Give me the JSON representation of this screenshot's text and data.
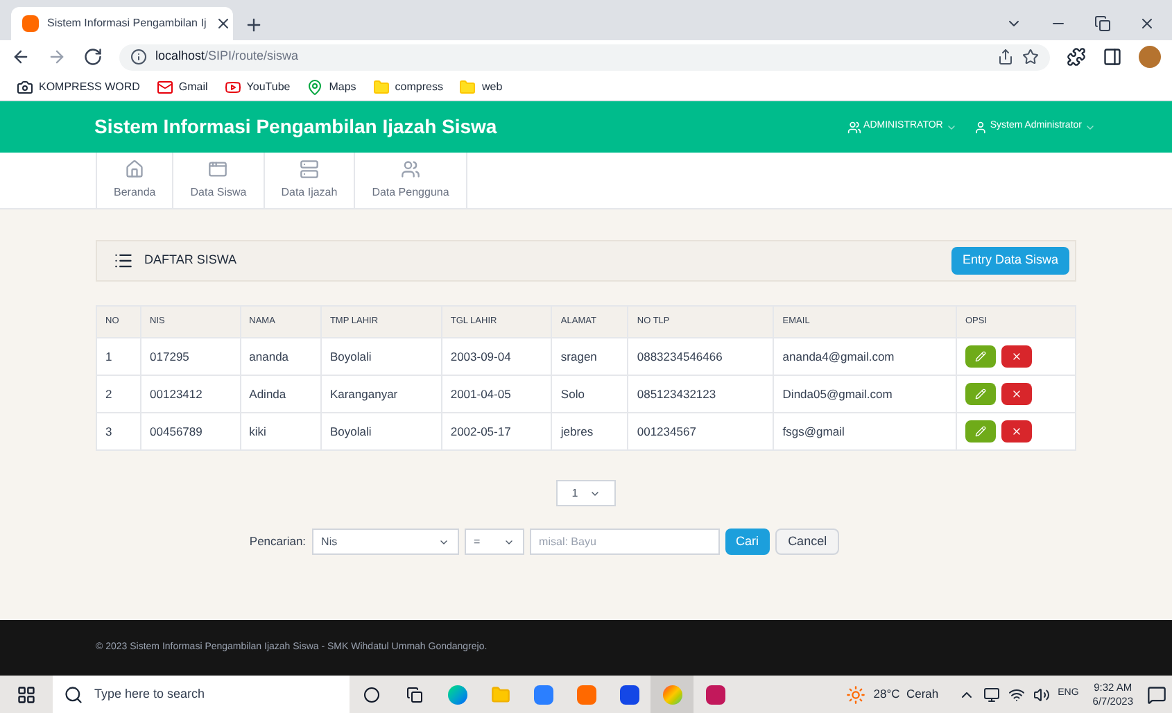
{
  "browser": {
    "tab_title": "Sistem Informasi Pengambilan Ij",
    "url_host": "localhost",
    "url_path": "/SIPI/route/siswa",
    "bookmarks": [
      {
        "label": "KOMPRESS WORD",
        "kind": "camera"
      },
      {
        "label": "Gmail",
        "kind": "gmail"
      },
      {
        "label": "YouTube",
        "kind": "youtube"
      },
      {
        "label": "Maps",
        "kind": "maps"
      },
      {
        "label": "compress",
        "kind": "folder"
      },
      {
        "label": "web",
        "kind": "folder"
      }
    ]
  },
  "header": {
    "title": "Sistem Informasi Pengambilan Ijazah Siswa",
    "role_menu": "ADMINISTRATOR",
    "user_menu": "System Administrator"
  },
  "nav": [
    {
      "label": "Beranda",
      "kind": "home",
      "selected": false
    },
    {
      "label": "Data Siswa",
      "kind": "window",
      "selected": false
    },
    {
      "label": "Data Ijazah",
      "kind": "server",
      "selected": false
    },
    {
      "label": "Data Pengguna",
      "kind": "users",
      "selected": false
    }
  ],
  "panel": {
    "title": "DAFTAR SISWA",
    "entry_button": "Entry Data Siswa"
  },
  "table": {
    "columns": [
      "NO",
      "NIS",
      "NAMA",
      "TMP LAHIR",
      "TGL LAHIR",
      "ALAMAT",
      "NO TLP",
      "EMAIL",
      "OPSI"
    ],
    "rows": [
      [
        "1",
        "017295",
        "ananda",
        "Boyolali",
        "2003-09-04",
        "sragen",
        "0883234546466",
        "ananda4@gmail.com"
      ],
      [
        "2",
        "00123412",
        "Adinda",
        "Karanganyar",
        "2001-04-05",
        "Solo",
        "085123432123",
        "Dinda05@gmail.com"
      ],
      [
        "3",
        "00456789",
        "kiki",
        "Boyolali",
        "2002-05-17",
        "jebres",
        "001234567",
        "fsgs@gmail"
      ]
    ]
  },
  "pagination": {
    "value": "1"
  },
  "search": {
    "label": "Pencarian:",
    "field": "Nis",
    "operator": "=",
    "placeholder": "misal: Bayu",
    "search_button": "Cari",
    "cancel_button": "Cancel"
  },
  "footer": "© 2023 Sistem Informasi Pengambilan Ijazah Siswa - SMK Wihdatul Ummah Gondangrejo.",
  "taskbar": {
    "search_placeholder": "Type here to search",
    "weather": "28°C  Cerah",
    "language": "ENG",
    "time": "9:32 AM",
    "date": "6/7/2023"
  }
}
